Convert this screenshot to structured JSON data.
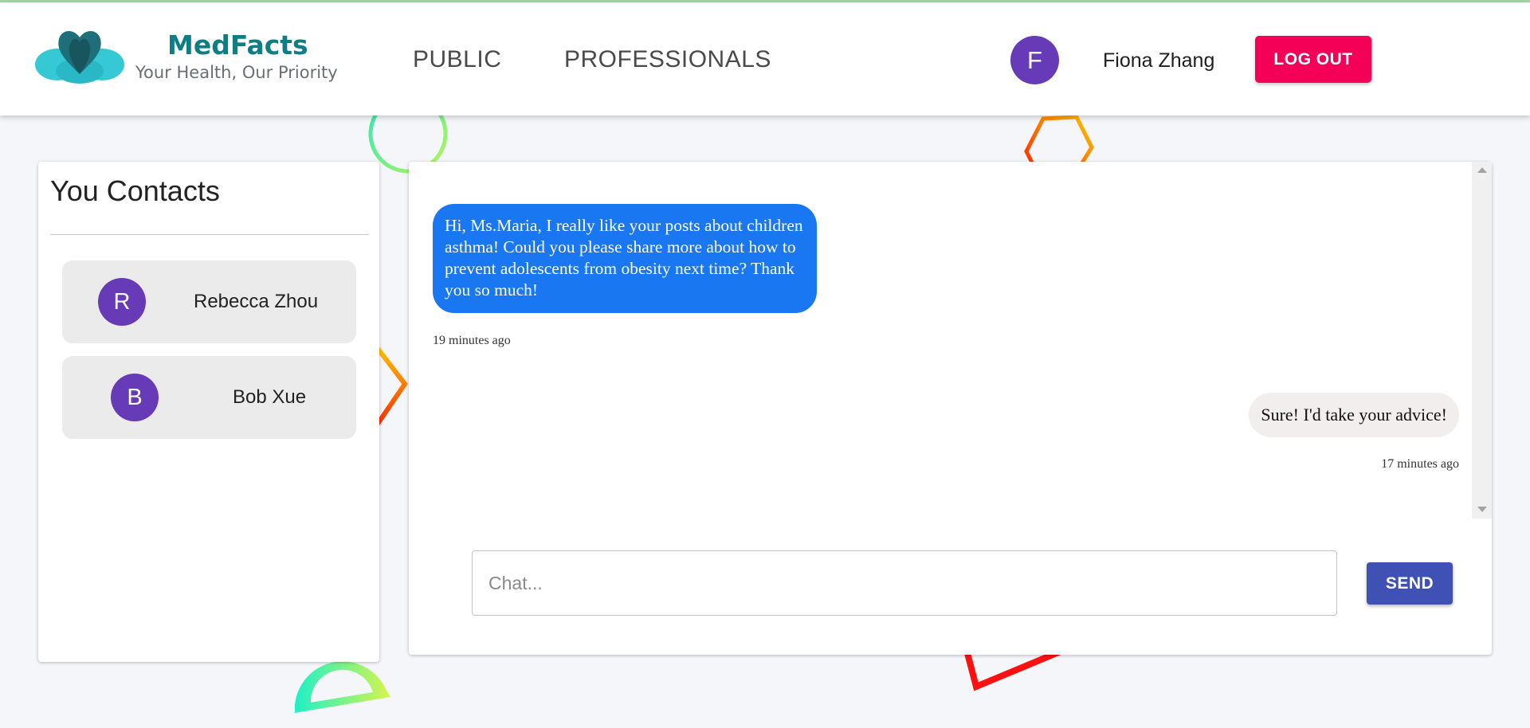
{
  "header": {
    "brand_name": "MedFacts",
    "tagline": "Your Health, Our Priority",
    "nav": [
      {
        "label": "PUBLIC"
      },
      {
        "label": "PROFESSIONALS"
      }
    ],
    "user": {
      "initial": "F",
      "name": "Fiona Zhang"
    },
    "logout_label": "LOG OUT"
  },
  "contacts": {
    "title": "You Contacts",
    "items": [
      {
        "initial": "R",
        "name": "Rebecca Zhou"
      },
      {
        "initial": "B",
        "name": "Bob Xue"
      }
    ]
  },
  "chat": {
    "messages": [
      {
        "direction": "incoming",
        "text": "Hi, Ms.Maria, I really like your posts about children asthma! Could you please share more about how to prevent adolescents from obesity next time? Thank you so much!",
        "time": "19 minutes ago"
      },
      {
        "direction": "outgoing",
        "text": "Sure! I'd take your advice!",
        "time": "17 minutes ago"
      }
    ],
    "input_placeholder": "Chat...",
    "send_label": "SEND"
  },
  "colors": {
    "brand": "#0f7e84",
    "avatar": "#673ab7",
    "logout": "#f50057",
    "send": "#3f51b5",
    "incoming_bubble": "#1a77f2",
    "outgoing_bubble": "#f2eeee"
  }
}
